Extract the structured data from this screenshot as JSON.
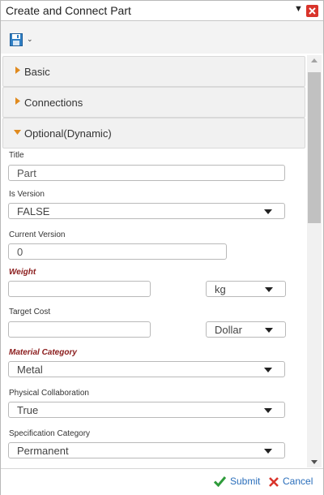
{
  "window": {
    "title": "Create and Connect Part"
  },
  "toolbar": {
    "save_icon": "save-icon",
    "menu_icon": "chevron-down-icon"
  },
  "sections": {
    "basic": {
      "label": "Basic",
      "expanded": false
    },
    "connections": {
      "label": "Connections",
      "expanded": false
    },
    "optional": {
      "label": "Optional(Dynamic)",
      "expanded": true
    }
  },
  "form": {
    "title": {
      "label": "Title",
      "placeholder": "Part",
      "value": ""
    },
    "is_version": {
      "label": "Is Version",
      "value": "FALSE"
    },
    "current_version": {
      "label": "Current Version",
      "placeholder": "0",
      "value": ""
    },
    "weight": {
      "label": "Weight",
      "required": true,
      "value": "",
      "unit": "kg"
    },
    "target_cost": {
      "label": "Target Cost",
      "value": "",
      "unit": "Dollar"
    },
    "material_category": {
      "label": "Material Category",
      "required": true,
      "value": "Metal"
    },
    "physical_collaboration": {
      "label": "Physical Collaboration",
      "value": "True"
    },
    "specification_category": {
      "label": "Specification Category",
      "value": "Permanent"
    }
  },
  "footer": {
    "submit_label": "Submit",
    "cancel_label": "Cancel"
  },
  "colors": {
    "accent_orange": "#e08a1e",
    "required_label": "#8a1b1b",
    "link_blue": "#2a6ebb",
    "close_red": "#d9342b",
    "submit_green": "#2e9b3a"
  }
}
